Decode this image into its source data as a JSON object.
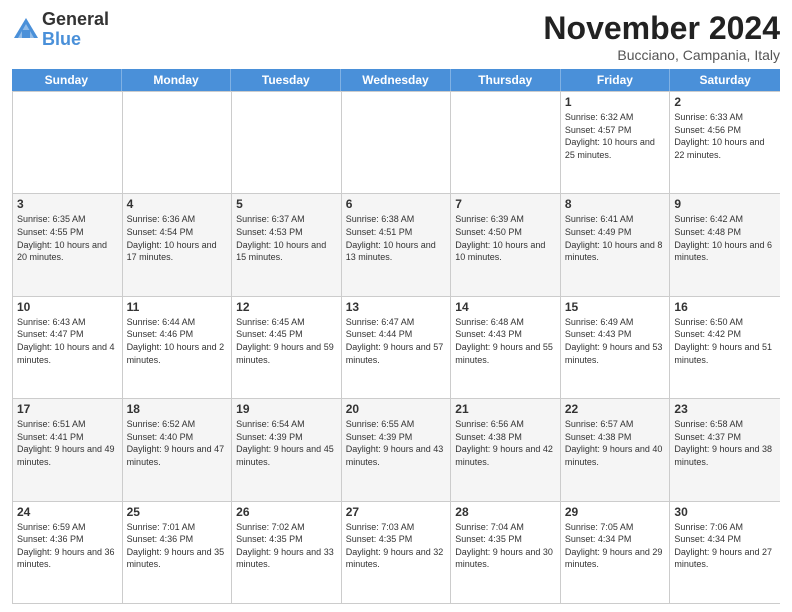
{
  "logo": {
    "general": "General",
    "blue": "Blue"
  },
  "header": {
    "month": "November 2024",
    "location": "Bucciano, Campania, Italy"
  },
  "weekdays": [
    "Sunday",
    "Monday",
    "Tuesday",
    "Wednesday",
    "Thursday",
    "Friday",
    "Saturday"
  ],
  "weeks": [
    [
      {
        "day": "",
        "info": ""
      },
      {
        "day": "",
        "info": ""
      },
      {
        "day": "",
        "info": ""
      },
      {
        "day": "",
        "info": ""
      },
      {
        "day": "",
        "info": ""
      },
      {
        "day": "1",
        "info": "Sunrise: 6:32 AM\nSunset: 4:57 PM\nDaylight: 10 hours and 25 minutes."
      },
      {
        "day": "2",
        "info": "Sunrise: 6:33 AM\nSunset: 4:56 PM\nDaylight: 10 hours and 22 minutes."
      }
    ],
    [
      {
        "day": "3",
        "info": "Sunrise: 6:35 AM\nSunset: 4:55 PM\nDaylight: 10 hours and 20 minutes."
      },
      {
        "day": "4",
        "info": "Sunrise: 6:36 AM\nSunset: 4:54 PM\nDaylight: 10 hours and 17 minutes."
      },
      {
        "day": "5",
        "info": "Sunrise: 6:37 AM\nSunset: 4:53 PM\nDaylight: 10 hours and 15 minutes."
      },
      {
        "day": "6",
        "info": "Sunrise: 6:38 AM\nSunset: 4:51 PM\nDaylight: 10 hours and 13 minutes."
      },
      {
        "day": "7",
        "info": "Sunrise: 6:39 AM\nSunset: 4:50 PM\nDaylight: 10 hours and 10 minutes."
      },
      {
        "day": "8",
        "info": "Sunrise: 6:41 AM\nSunset: 4:49 PM\nDaylight: 10 hours and 8 minutes."
      },
      {
        "day": "9",
        "info": "Sunrise: 6:42 AM\nSunset: 4:48 PM\nDaylight: 10 hours and 6 minutes."
      }
    ],
    [
      {
        "day": "10",
        "info": "Sunrise: 6:43 AM\nSunset: 4:47 PM\nDaylight: 10 hours and 4 minutes."
      },
      {
        "day": "11",
        "info": "Sunrise: 6:44 AM\nSunset: 4:46 PM\nDaylight: 10 hours and 2 minutes."
      },
      {
        "day": "12",
        "info": "Sunrise: 6:45 AM\nSunset: 4:45 PM\nDaylight: 9 hours and 59 minutes."
      },
      {
        "day": "13",
        "info": "Sunrise: 6:47 AM\nSunset: 4:44 PM\nDaylight: 9 hours and 57 minutes."
      },
      {
        "day": "14",
        "info": "Sunrise: 6:48 AM\nSunset: 4:43 PM\nDaylight: 9 hours and 55 minutes."
      },
      {
        "day": "15",
        "info": "Sunrise: 6:49 AM\nSunset: 4:43 PM\nDaylight: 9 hours and 53 minutes."
      },
      {
        "day": "16",
        "info": "Sunrise: 6:50 AM\nSunset: 4:42 PM\nDaylight: 9 hours and 51 minutes."
      }
    ],
    [
      {
        "day": "17",
        "info": "Sunrise: 6:51 AM\nSunset: 4:41 PM\nDaylight: 9 hours and 49 minutes."
      },
      {
        "day": "18",
        "info": "Sunrise: 6:52 AM\nSunset: 4:40 PM\nDaylight: 9 hours and 47 minutes."
      },
      {
        "day": "19",
        "info": "Sunrise: 6:54 AM\nSunset: 4:39 PM\nDaylight: 9 hours and 45 minutes."
      },
      {
        "day": "20",
        "info": "Sunrise: 6:55 AM\nSunset: 4:39 PM\nDaylight: 9 hours and 43 minutes."
      },
      {
        "day": "21",
        "info": "Sunrise: 6:56 AM\nSunset: 4:38 PM\nDaylight: 9 hours and 42 minutes."
      },
      {
        "day": "22",
        "info": "Sunrise: 6:57 AM\nSunset: 4:38 PM\nDaylight: 9 hours and 40 minutes."
      },
      {
        "day": "23",
        "info": "Sunrise: 6:58 AM\nSunset: 4:37 PM\nDaylight: 9 hours and 38 minutes."
      }
    ],
    [
      {
        "day": "24",
        "info": "Sunrise: 6:59 AM\nSunset: 4:36 PM\nDaylight: 9 hours and 36 minutes."
      },
      {
        "day": "25",
        "info": "Sunrise: 7:01 AM\nSunset: 4:36 PM\nDaylight: 9 hours and 35 minutes."
      },
      {
        "day": "26",
        "info": "Sunrise: 7:02 AM\nSunset: 4:35 PM\nDaylight: 9 hours and 33 minutes."
      },
      {
        "day": "27",
        "info": "Sunrise: 7:03 AM\nSunset: 4:35 PM\nDaylight: 9 hours and 32 minutes."
      },
      {
        "day": "28",
        "info": "Sunrise: 7:04 AM\nSunset: 4:35 PM\nDaylight: 9 hours and 30 minutes."
      },
      {
        "day": "29",
        "info": "Sunrise: 7:05 AM\nSunset: 4:34 PM\nDaylight: 9 hours and 29 minutes."
      },
      {
        "day": "30",
        "info": "Sunrise: 7:06 AM\nSunset: 4:34 PM\nDaylight: 9 hours and 27 minutes."
      }
    ]
  ],
  "alt_rows": [
    1,
    3
  ]
}
